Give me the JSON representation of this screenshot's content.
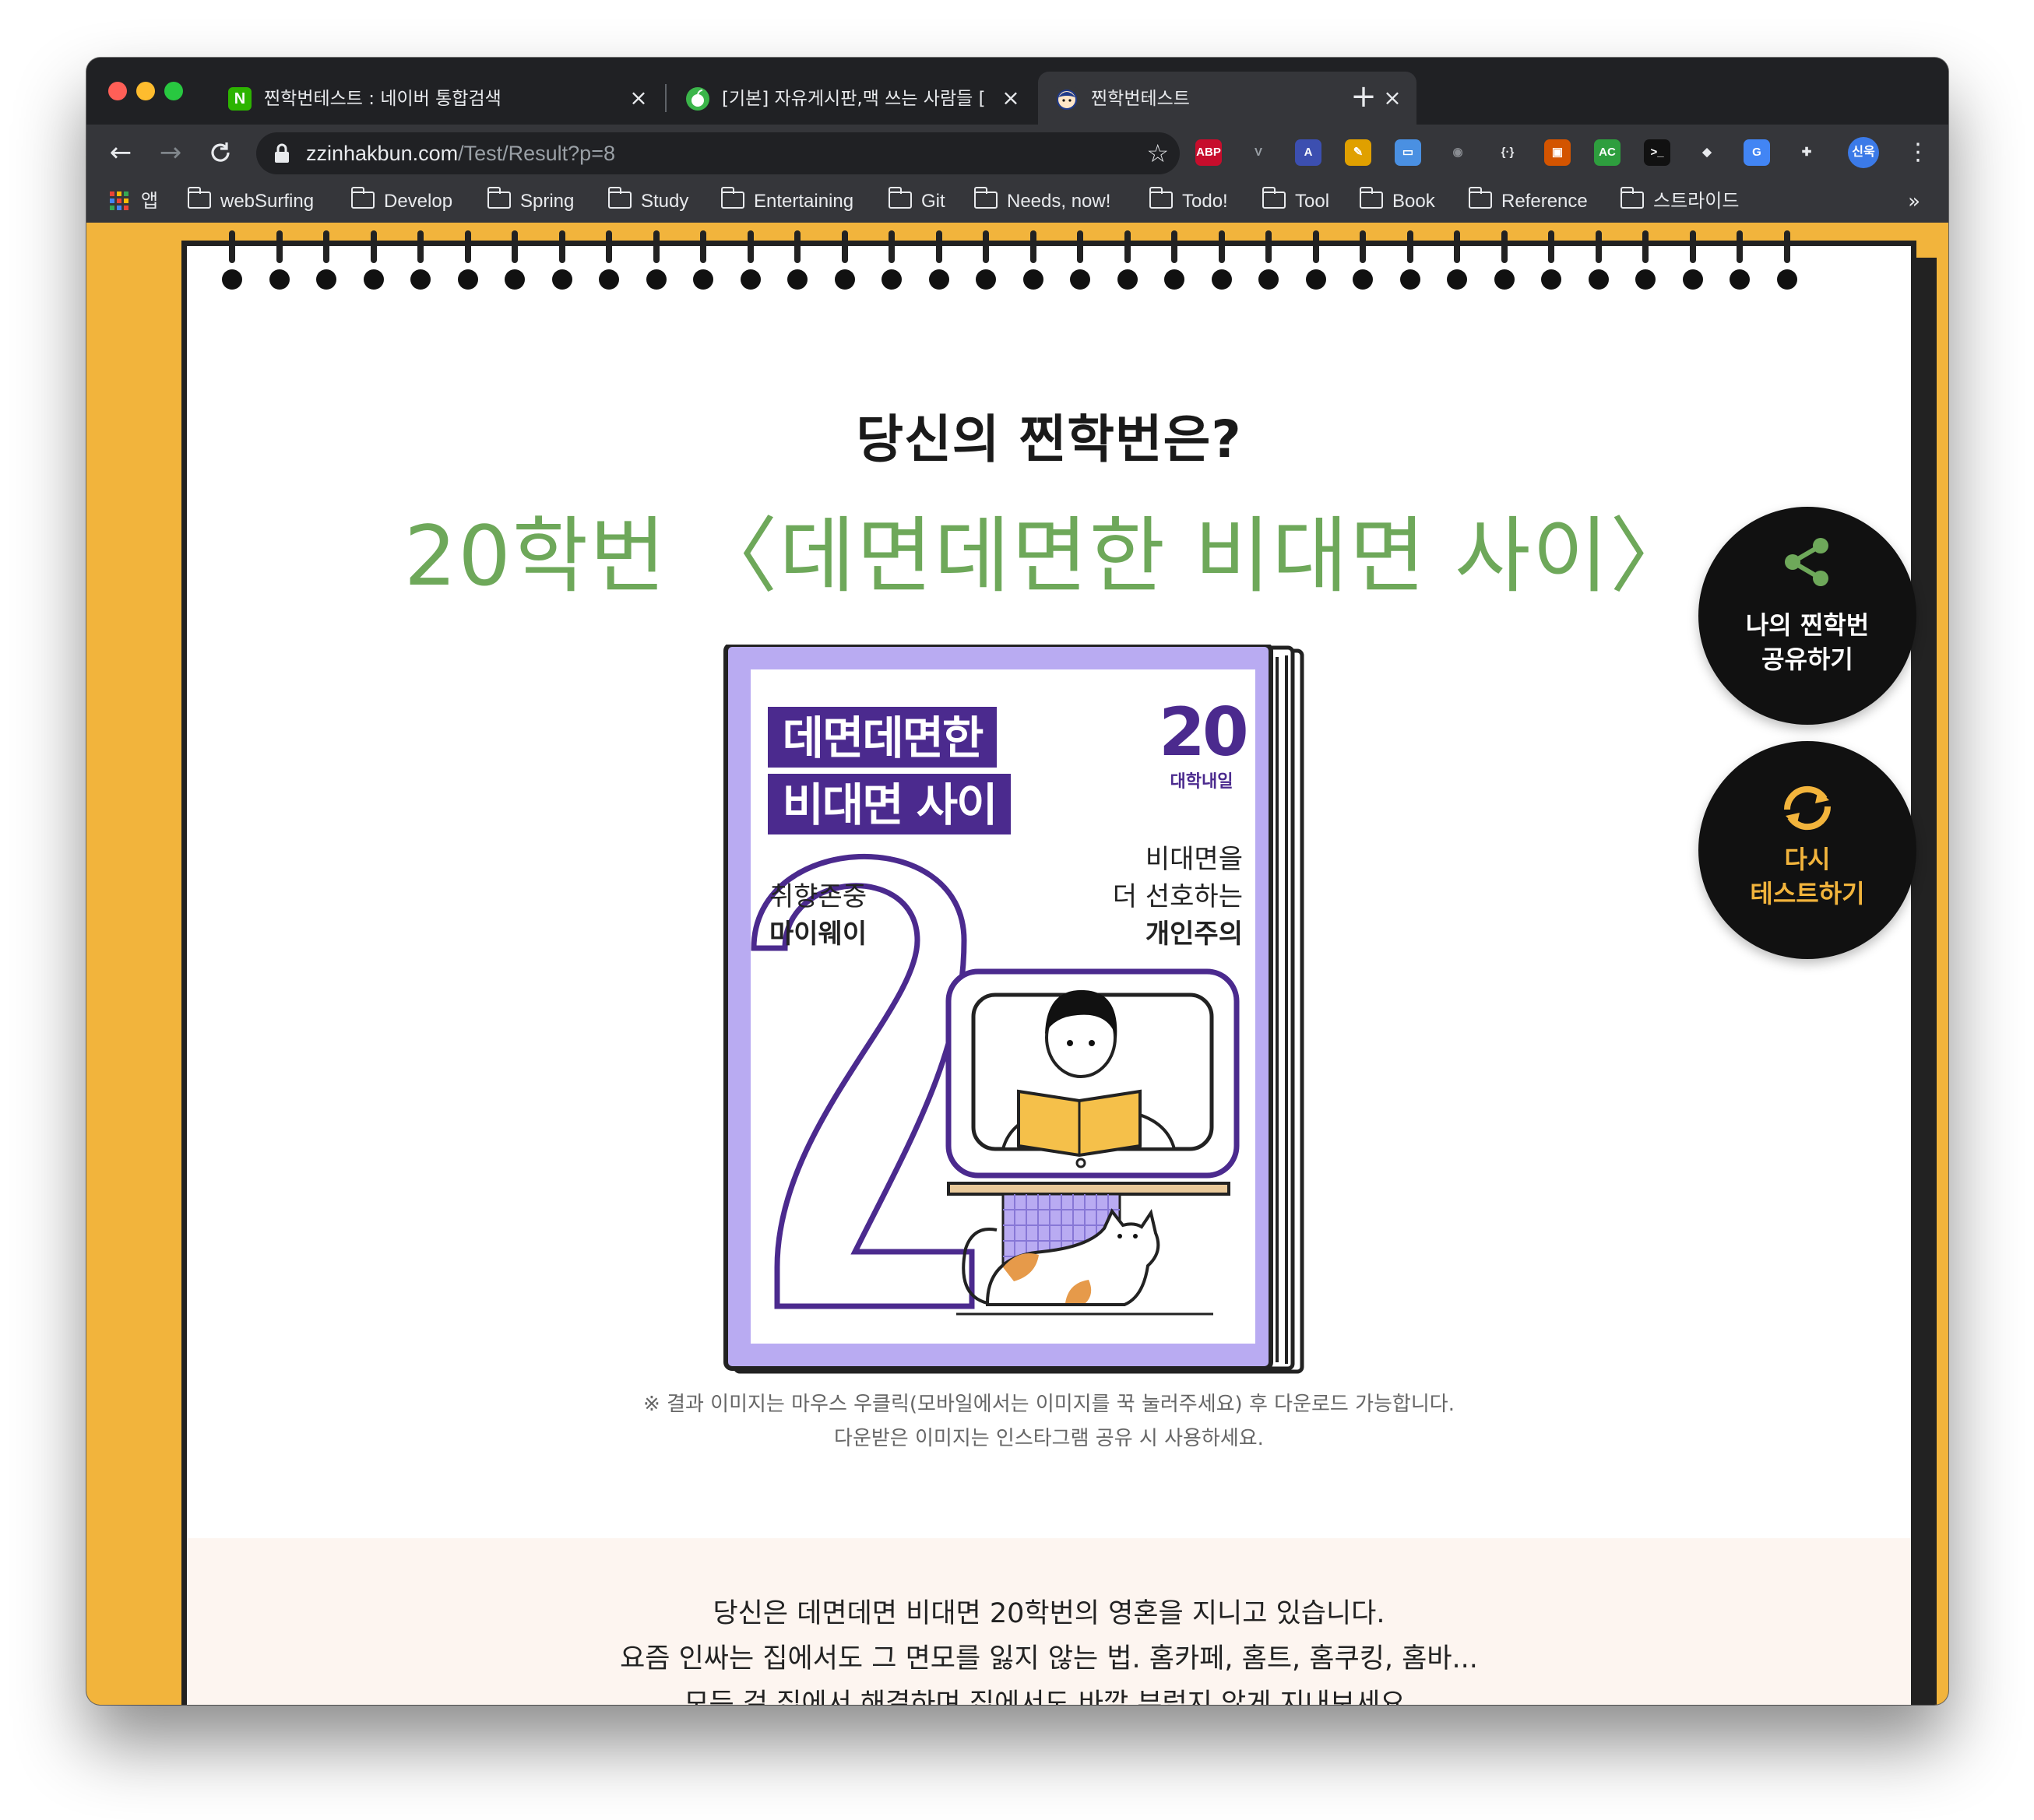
{
  "browser": {
    "tabs": [
      {
        "title": "찐학번테스트 : 네이버 통합검색",
        "favicon": "N",
        "favicon_color": "#2db400"
      },
      {
        "title": "[기본] 자유게시판,맥 쓰는 사람들 [카",
        "favicon": "apple",
        "favicon_color": "#3bb54a"
      },
      {
        "title": "찐학번테스트",
        "favicon": "face"
      }
    ],
    "url_host": "zzinhakbun.com",
    "url_path": "/Test/Result?p=8",
    "extensions": [
      {
        "name": "abp-icon",
        "label": "ABP",
        "color": "#c70d2c"
      },
      {
        "name": "vue-icon",
        "label": "V",
        "color": "#9aa0a6"
      },
      {
        "name": "avatar-ext-icon",
        "label": "A",
        "color": "#3c4fb0"
      },
      {
        "name": "eyedropper-icon",
        "label": "✎",
        "color": "#e0a000"
      },
      {
        "name": "window-icon",
        "label": "▭",
        "color": "#4a90e2"
      },
      {
        "name": "bulb-icon",
        "label": "◉",
        "color": "#8a8d92"
      },
      {
        "name": "code-icon",
        "label": "{·}",
        "color": "#e8eaed"
      },
      {
        "name": "screenshot-icon",
        "label": "▣",
        "color": "#d35400"
      },
      {
        "name": "ac-icon",
        "label": "AC",
        "color": "#2e9e3e"
      },
      {
        "name": "terminal-icon",
        "label": ">_",
        "color": "#111111"
      },
      {
        "name": "diamond-icon",
        "label": "◆",
        "color": "#e8eaed"
      },
      {
        "name": "translate-icon",
        "label": "G",
        "color": "#4285f4"
      },
      {
        "name": "puzzle-icon",
        "label": "✚",
        "color": "#e8eaed"
      }
    ],
    "profile_label": "신욱",
    "bookmarks": [
      {
        "label": "앱",
        "type": "apps"
      },
      {
        "label": "webSurfing",
        "type": "folder"
      },
      {
        "label": "Develop",
        "type": "folder"
      },
      {
        "label": "Spring",
        "type": "folder"
      },
      {
        "label": "Study",
        "type": "folder"
      },
      {
        "label": "Entertaining",
        "type": "folder"
      },
      {
        "label": "Git",
        "type": "folder"
      },
      {
        "label": "Needs, now!",
        "type": "folder"
      },
      {
        "label": "Todo!",
        "type": "folder"
      },
      {
        "label": "Tool",
        "type": "folder"
      },
      {
        "label": "Book",
        "type": "folder"
      },
      {
        "label": "Reference",
        "type": "folder"
      },
      {
        "label": "스트라이드",
        "type": "folder"
      }
    ],
    "bookmarks_more": "»"
  },
  "page": {
    "question": "당신의 찐학번은?",
    "result_title": "20학번 〈데면데면한 비대면 사이〉",
    "card": {
      "title_line1": "데면데면한",
      "title_line2": "비대면 사이",
      "logo_number": "20",
      "logo_text": "대학내일",
      "tag_left_line1": "취향존중",
      "tag_left_line2": "마이웨이",
      "tag_right_line1": "비대면을",
      "tag_right_line2": "더 선호하는",
      "tag_right_line3": "개인주의"
    },
    "notice_line1": "※ 결과 이미지는 마우스 우클릭(모바일에서는 이미지를 꾹 눌러주세요) 후 다운로드 가능합니다.",
    "notice_line2": "다운받은 이미지는 인스타그램 공유 시 사용하세요.",
    "description": [
      "당신은 데면데면 비대면 20학번의 영혼을 지니고 있습니다.",
      "요즘 인싸는 집에서도 그 면모를 잃지 않는 법. 홈카페, 홈트, 홈쿠킹, 홈바...",
      "모든 걸 집에서 해결하며 집에서도 바깥 부럽지 않게 지내보세요."
    ],
    "share_button": {
      "line1": "나의 찐학번",
      "line2": "공유하기"
    },
    "retry_button": {
      "line1": "다시",
      "line2": "테스트하기"
    }
  },
  "colors": {
    "page_background": "#f2b43c",
    "title_green": "#6ea85a",
    "card_purple": "#b9abf2",
    "card_dark_purple": "#4b2a8e",
    "retry_yellow": "#f2b43c"
  }
}
